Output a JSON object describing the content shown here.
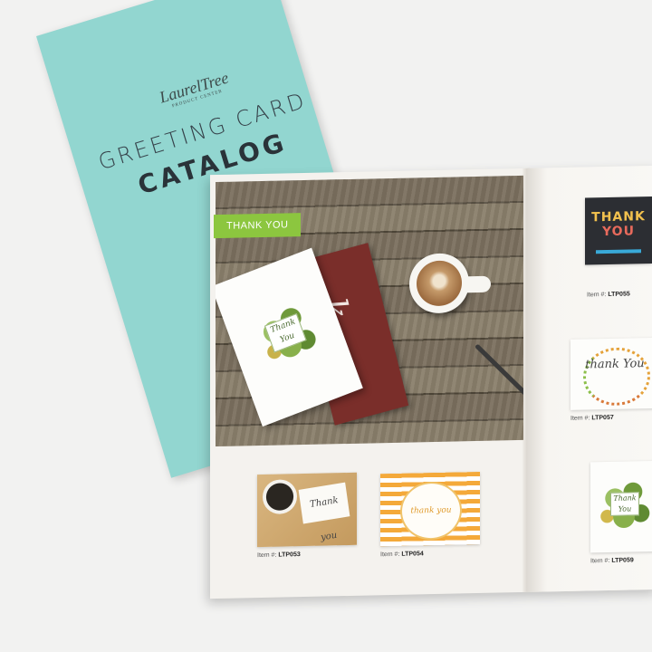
{
  "cover": {
    "brand": "LaurelTree",
    "brand_sub": "PRODUCT CENTER",
    "title_line1": "GREETING CARD",
    "title_line2": "CATALOG",
    "color": "#92d6d0"
  },
  "spread": {
    "section_badge": "THANK YOU",
    "badge_color": "#8cc63f",
    "hero_card_text": "Thank You",
    "maroon_card_text": "k"
  },
  "products": [
    {
      "item_label": "Item #:",
      "item_code": "LTP053",
      "card_text": "Thank you"
    },
    {
      "item_label": "Item #:",
      "item_code": "LTP054",
      "card_text": "thank you"
    },
    {
      "item_label": "Item #:",
      "item_code": "LTP055",
      "card_text_line1": "THANK",
      "card_text_line2": "YOU"
    },
    {
      "item_label": "Item #:",
      "item_code": "LTP057",
      "card_text": "thank You"
    },
    {
      "item_label": "Item #:",
      "item_code": "LTP059",
      "card_text": "Thank You"
    }
  ]
}
